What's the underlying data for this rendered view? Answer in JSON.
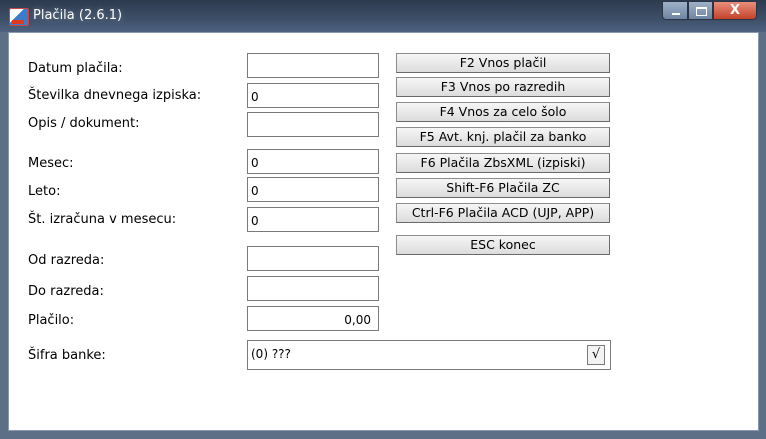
{
  "window": {
    "title": "Plačila  (2.6.1)",
    "close_glyph": "X"
  },
  "form": {
    "datum_label": "Datum plačila:",
    "datum_value": "",
    "stevilka_label": "Številka dnevnega izpiska:",
    "stevilka_value": "0",
    "opis_label": "Opis / dokument:",
    "opis_value": "",
    "mesec_label": "Mesec:",
    "mesec_value": "0",
    "leto_label": "Leto:",
    "leto_value": "0",
    "st_izracuna_label": "Št. izračuna v mesecu:",
    "st_izracuna_value": "0",
    "od_razreda_label": "Od razreda:",
    "od_razreda_value": "",
    "do_razreda_label": "Do razreda:",
    "do_razreda_value": "",
    "placilo_label": "Plačilo:",
    "placilo_value": "0,00",
    "sifra_banke_label": "Šifra banke:",
    "sifra_banke_value": "(0) ???",
    "sifra_banke_button": "√"
  },
  "buttons": {
    "f2": "F2 Vnos plačil",
    "f3": "F3 Vnos po razredih",
    "f4": "F4 Vnos za celo šolo",
    "f5": "F5 Avt. knj. plačil za banko",
    "f6": "F6 Plačila ZbsXML (izpiski)",
    "shift_f6": "Shift-F6 Plačila ZC",
    "ctrl_f6": "Ctrl-F6 Plačila ACD (UJP, APP)",
    "esc": "ESC  konec"
  }
}
